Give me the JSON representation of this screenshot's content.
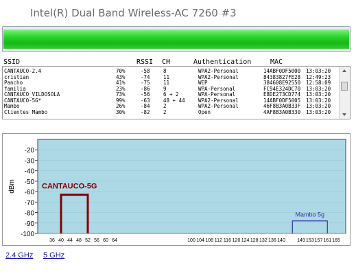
{
  "window": {
    "title": "Intel(R) Dual Band Wireless-AC 7260 #3"
  },
  "signal": {
    "level_percent": 100,
    "color": "#22cc22"
  },
  "table": {
    "headers": {
      "ssid": "SSID",
      "rssi": "RSSI",
      "ch": "CH",
      "auth": "Authentication",
      "mac": "MAC"
    },
    "rows": [
      {
        "ssid": "CANTAUCO-2.4",
        "pct": "70%",
        "rssi": "-58",
        "ch": "8",
        "auth": "WPA2-Personal",
        "mac": "14ABF0DF5000",
        "time": "13:03:20"
      },
      {
        "ssid": "cristian",
        "pct": "43%",
        "rssi": "-74",
        "ch": "11",
        "auth": "WPA2-Personal",
        "mac": "84383827FE28",
        "time": "12:49:23"
      },
      {
        "ssid": "Pancho",
        "pct": "41%",
        "rssi": "-75",
        "ch": "11",
        "auth": "WEP",
        "mac": "384608E92550",
        "time": "12:58:09"
      },
      {
        "ssid": "familia",
        "pct": "23%",
        "rssi": "-86",
        "ch": "9",
        "auth": "WPA-Personal",
        "mac": "FC94E324DC70",
        "time": "13:03:20"
      },
      {
        "ssid": "CANTAUCO_VILDOSOLA",
        "pct": "73%",
        "rssi": "-56",
        "ch": "6 + 2",
        "auth": "WPA-Personal",
        "mac": "E8DE273CD774",
        "time": "13:03:20"
      },
      {
        "ssid": "CANTAUCO-5G*",
        "pct": "99%",
        "rssi": "-63",
        "ch": "48 + 44",
        "auth": "WPA2-Personal",
        "mac": "14ABF0DF5005",
        "time": "13:03:20"
      },
      {
        "ssid": "Mambo",
        "pct": "26%",
        "rssi": "-84",
        "ch": "2",
        "auth": "WPA2-Personal",
        "mac": "46F8B3A0B33F",
        "time": "13:03:20"
      },
      {
        "ssid": "Clientes Mambo",
        "pct": "30%",
        "rssi": "-82",
        "ch": "2",
        "auth": "Open",
        "mac": "4AF8B3A0B330",
        "time": "13:03:20"
      }
    ]
  },
  "chart_data": {
    "type": "area",
    "ylabel": "dBm",
    "ylim": [
      -100,
      -10
    ],
    "y_ticks": [
      "-20",
      "-30",
      "-40",
      "-50",
      "-60",
      "-70",
      "-80",
      "-90",
      "-100"
    ],
    "x_tick_labels": [
      "36",
      "40",
      "44",
      "48",
      "52",
      "56",
      "60",
      "64",
      "100",
      "104",
      "108",
      "112",
      "116",
      "120",
      "124",
      "128",
      "132",
      "136",
      "140",
      "149",
      "153",
      "157",
      "161",
      "165"
    ],
    "x_tick_values": [
      36,
      40,
      44,
      48,
      52,
      56,
      60,
      64,
      100,
      104,
      108,
      112,
      116,
      120,
      124,
      128,
      132,
      136,
      140,
      149,
      153,
      157,
      161,
      165
    ],
    "networks": [
      {
        "name": "CANTAUCO-5G",
        "channel_from": 44,
        "channel_to": 48,
        "rssi": -63,
        "color": "#800000",
        "selected": true
      },
      {
        "name": "Mambo 5g",
        "channel_from": 149,
        "channel_to": 157,
        "rssi": -88,
        "color": "#3333aa",
        "selected": false
      }
    ],
    "plot_bg": "#add8e6",
    "grid": true
  },
  "tabs": [
    {
      "label": "2.4 GHz"
    },
    {
      "label": "5 GHz"
    }
  ]
}
